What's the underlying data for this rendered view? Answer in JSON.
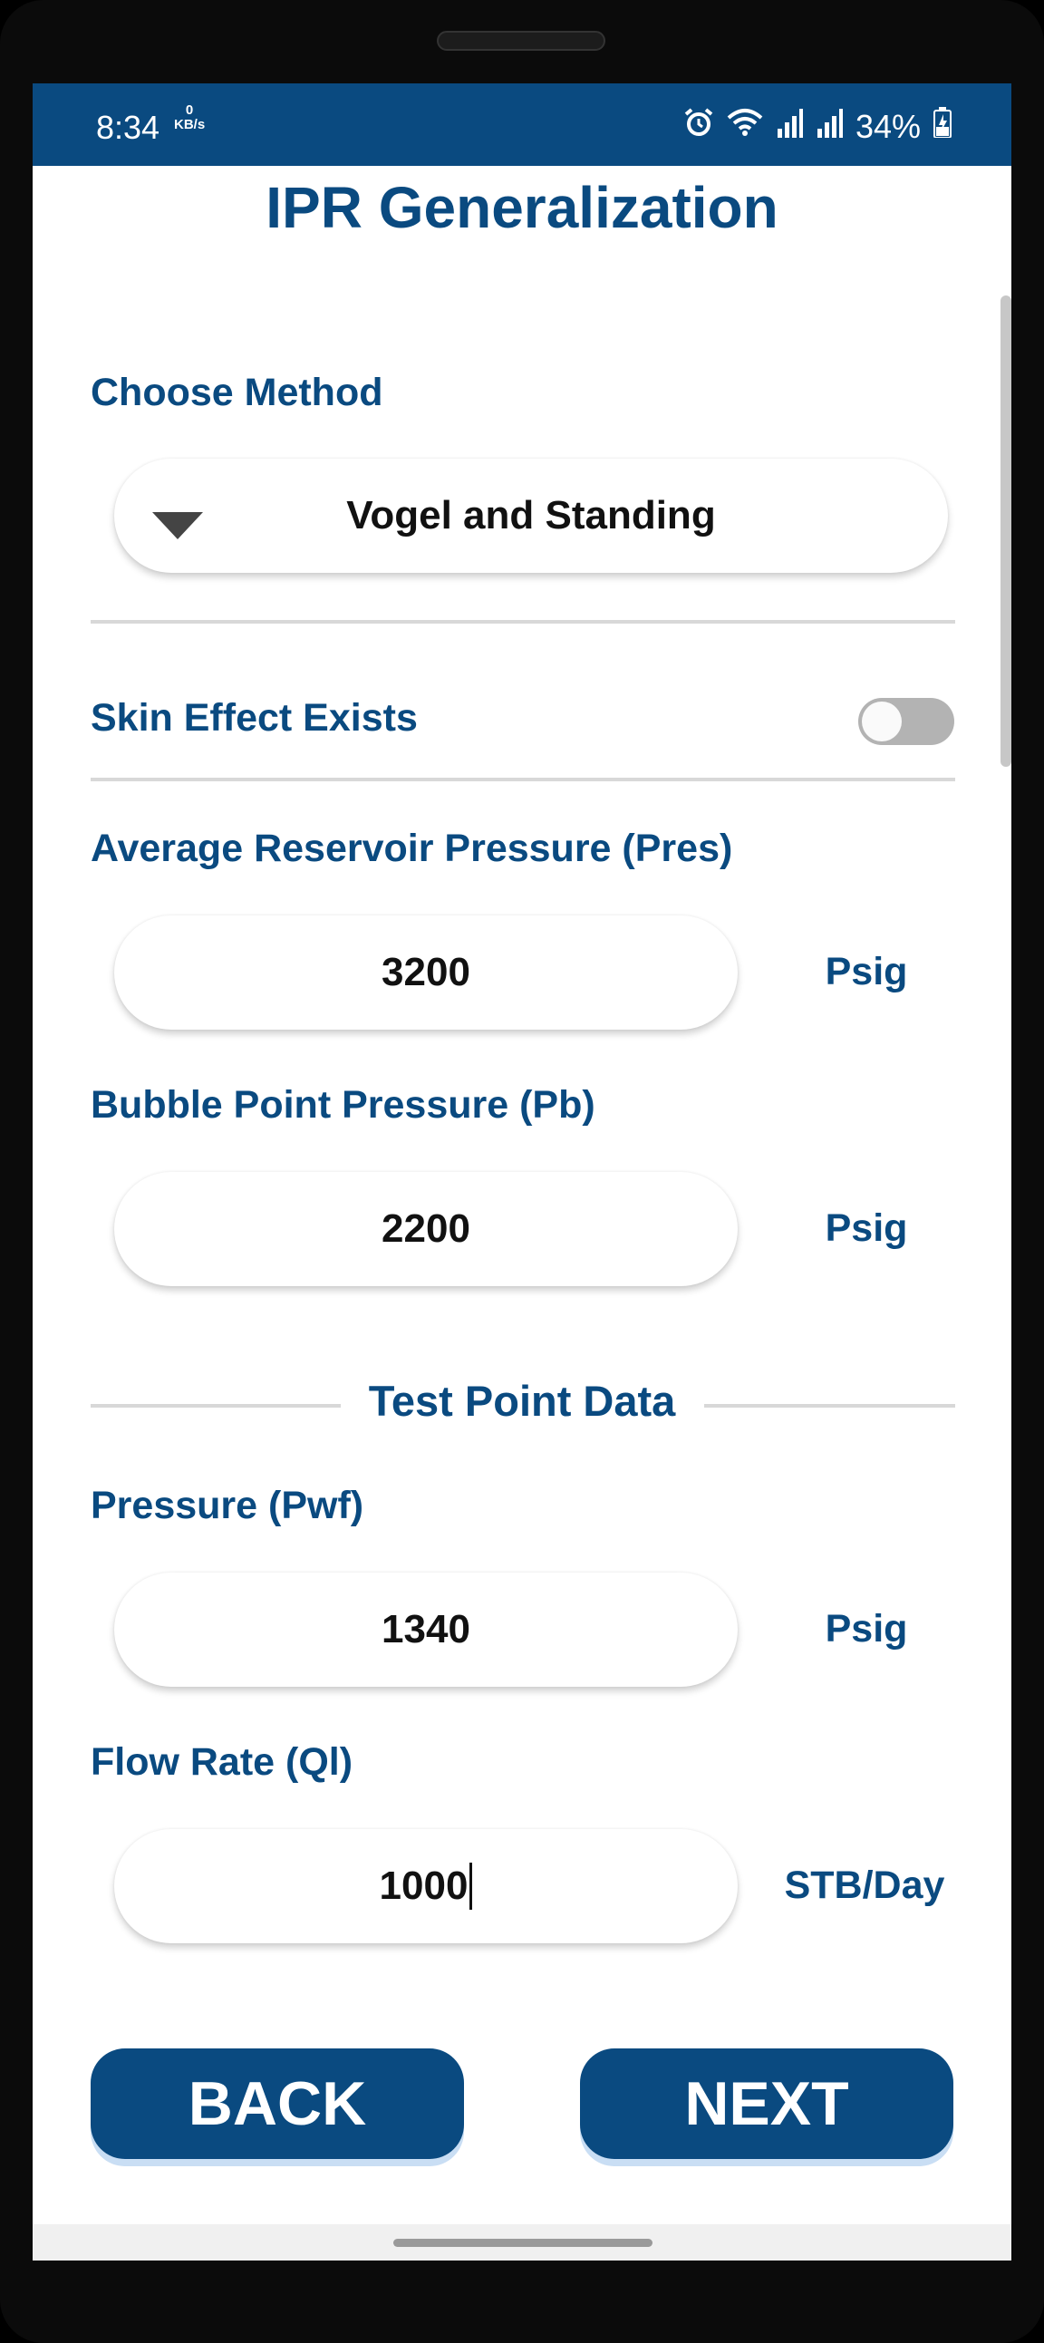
{
  "status_bar": {
    "time": "8:34",
    "net_speed": "0",
    "net_unit": "KB/s",
    "battery": "34%"
  },
  "title": "IPR Generalization",
  "method": {
    "label": "Choose Method",
    "selected": "Vogel and Standing"
  },
  "skin": {
    "label": "Skin Effect Exists",
    "enabled": false
  },
  "reservoir_pressure": {
    "label": "Average Reservoir Pressure (Pres)",
    "value": "3200",
    "unit": "Psig"
  },
  "bubble_point": {
    "label": "Bubble Point Pressure (Pb)",
    "value": "2200",
    "unit": "Psig"
  },
  "test_point": {
    "heading": "Test Point Data"
  },
  "pwf": {
    "label": "Pressure (Pwf)",
    "value": "1340",
    "unit": "Psig"
  },
  "flow_rate": {
    "label": "Flow Rate (Ql)",
    "value": "1000",
    "unit": "STB/Day"
  },
  "buttons": {
    "back": "BACK",
    "next": "NEXT"
  },
  "colors": {
    "primary": "#0a4a80",
    "divider": "#d8d8d8",
    "toggle_off": "#b3b3b3"
  }
}
